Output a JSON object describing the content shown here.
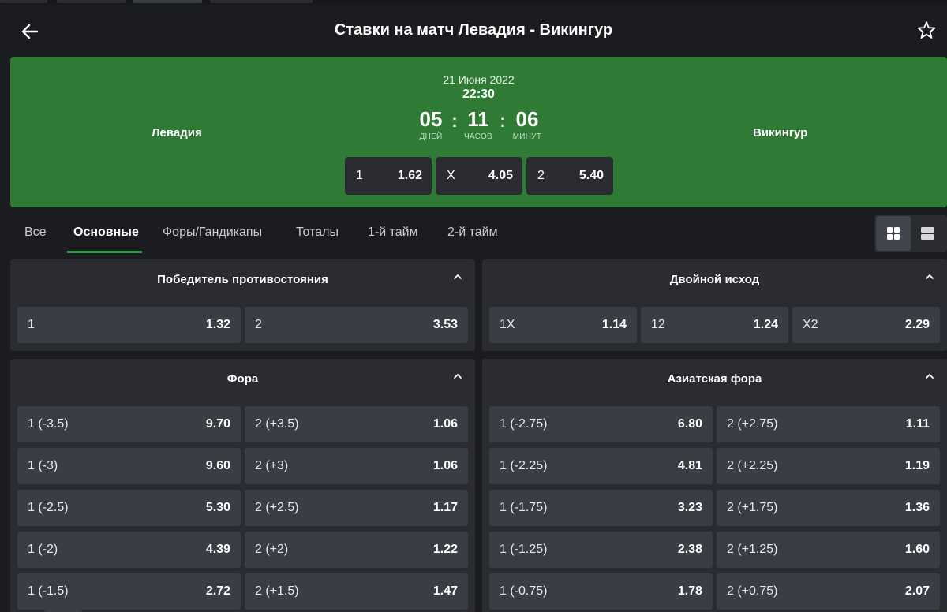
{
  "header": {
    "title": "Ставки на матч Левадия - Викингур",
    "back_icon": "arrow-left-icon",
    "favorite_icon": "star-icon"
  },
  "match": {
    "home_team": "Левадия",
    "away_team": "Викингур",
    "date": "21 Июня 2022",
    "time": "22:30",
    "countdown": [
      {
        "value": "05",
        "label": "ДНЕЙ"
      },
      {
        "value": "11",
        "label": "ЧАСОВ"
      },
      {
        "value": "06",
        "label": "МИНУТ"
      }
    ],
    "separator": ":",
    "odds": [
      {
        "label": "1",
        "value": "1.62"
      },
      {
        "label": "X",
        "value": "4.05"
      },
      {
        "label": "2",
        "value": "5.40"
      }
    ],
    "card_color": "#2f7b35"
  },
  "tabs": [
    "Все",
    "Основные",
    "Форы/Гандикапы",
    "Тоталы",
    "1-й тайм",
    "2-й тайм"
  ],
  "active_tab": "Основные",
  "view_switch": {
    "grid_icon": "grid-icon",
    "list_icon": "list-icon",
    "active": "grid"
  },
  "sections": {
    "winner": {
      "title": "Победитель противостояния",
      "odds": [
        {
          "label": "1",
          "value": "1.32"
        },
        {
          "label": "2",
          "value": "3.53"
        }
      ]
    },
    "double": {
      "title": "Двойной исход",
      "odds": [
        {
          "label": "1X",
          "value": "1.14"
        },
        {
          "label": "12",
          "value": "1.24"
        },
        {
          "label": "X2",
          "value": "2.29"
        }
      ]
    },
    "handicap": {
      "title": "Фора",
      "rows": [
        [
          {
            "label": "1 (-3.5)",
            "value": "9.70"
          },
          {
            "label": "2 (+3.5)",
            "value": "1.06"
          }
        ],
        [
          {
            "label": "1 (-3)",
            "value": "9.60"
          },
          {
            "label": "2 (+3)",
            "value": "1.06"
          }
        ],
        [
          {
            "label": "1 (-2.5)",
            "value": "5.30"
          },
          {
            "label": "2 (+2.5)",
            "value": "1.17"
          }
        ],
        [
          {
            "label": "1 (-2)",
            "value": "4.39"
          },
          {
            "label": "2 (+2)",
            "value": "1.22"
          }
        ],
        [
          {
            "label": "1 (-1.5)",
            "value": "2.72"
          },
          {
            "label": "2 (+1.5)",
            "value": "1.47"
          }
        ]
      ]
    },
    "asian": {
      "title": "Азиатская фора",
      "rows": [
        [
          {
            "label": "1 (-2.75)",
            "value": "6.80"
          },
          {
            "label": "2 (+2.75)",
            "value": "1.11"
          }
        ],
        [
          {
            "label": "1 (-2.25)",
            "value": "4.81"
          },
          {
            "label": "2 (+2.25)",
            "value": "1.19"
          }
        ],
        [
          {
            "label": "1 (-1.75)",
            "value": "3.23"
          },
          {
            "label": "2 (+1.75)",
            "value": "1.36"
          }
        ],
        [
          {
            "label": "1 (-1.25)",
            "value": "2.38"
          },
          {
            "label": "2 (+1.25)",
            "value": "1.60"
          }
        ],
        [
          {
            "label": "1 (-0.75)",
            "value": "1.78"
          },
          {
            "label": "2 (+0.75)",
            "value": "2.07"
          }
        ]
      ]
    }
  },
  "colors": {
    "background": "#1b1c1f",
    "panel": "#2a2c31",
    "button": "#3a3d44",
    "accent": "#2f9a45"
  }
}
